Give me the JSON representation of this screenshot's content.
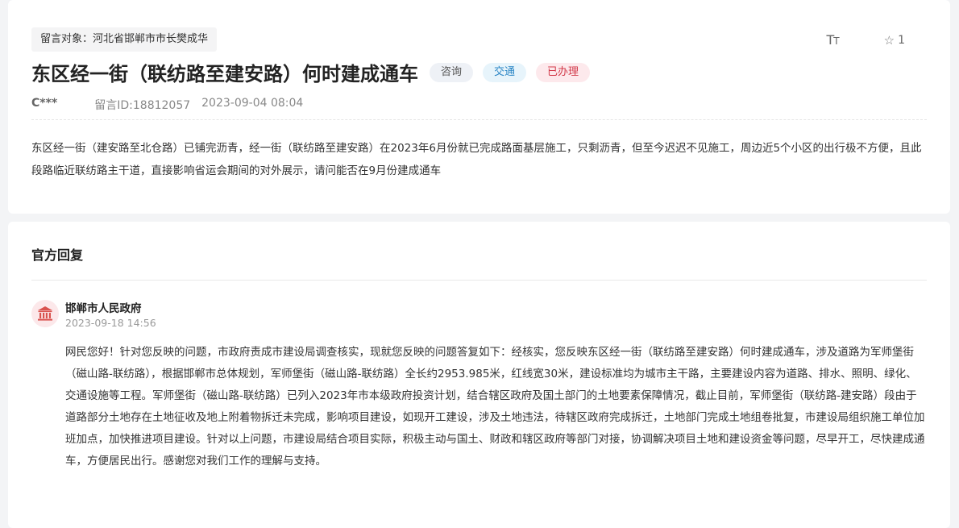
{
  "message": {
    "target_label": "留言对象：河北省邯郸市市长樊成华",
    "title": "东区经一街（联纺路至建安路）何时建成通车",
    "tags": [
      {
        "label": "咨询",
        "color": "#555555",
        "bg": "#eef1f6"
      },
      {
        "label": "交通",
        "color": "#2b86c5",
        "bg": "#e7f4fb"
      },
      {
        "label": "已办理",
        "color": "#d23a4a",
        "bg": "#fde9ec"
      }
    ],
    "author": "C***",
    "message_id": "留言ID:18812057",
    "datetime": "2023-09-04 08:04",
    "content": "东区经一街（建安路至北仓路）已铺完沥青，经一街（联纺路至建安路）在2023年6月份就已完成路面基层施工，只剩沥青，但至今迟迟不见施工，周边近5个小区的出行极不方便，且此段路临近联纺路主干道，直接影响省运会期间的对外展示，请问能否在9月份建成通车"
  },
  "toolbar": {
    "font_size_icon": "font-size-icon",
    "favorite_icon": "star-outline-icon",
    "favorite_count": "1"
  },
  "reply": {
    "heading": "官方回复",
    "avatar_icon": "government-building-icon",
    "avatar_color": "#d9534f",
    "department": "邯郸市人民政府",
    "datetime": "2023-09-18 14:56",
    "content": "网民您好！针对您反映的问题，市政府责成市建设局调查核实，现就您反映的问题答复如下：经核实，您反映东区经一街（联纺路至建安路）何时建成通车，涉及道路为军师堡街（磁山路-联纺路），根据邯郸市总体规划，军师堡街（磁山路-联纺路）全长约2953.985米，红线宽30米，建设标准均为城市主干路，主要建设内容为道路、排水、照明、绿化、交通设施等工程。军师堡街（磁山路-联纺路）已列入2023年市本级政府投资计划，结合辖区政府及国土部门的土地要素保障情况，截止目前，军师堡街（联纺路-建安路）段由于道路部分土地存在土地征收及地上附着物拆迁未完成，影响项目建设，如现开工建设，涉及土地违法，待辖区政府完成拆迁，土地部门完成土地组卷批复，市建设局组织施工单位加班加点，加快推进项目建设。针对以上问题，市建设局结合项目实际，积极主动与国土、财政和辖区政府等部门对接，协调解决项目土地和建设资金等问题，尽早开工，尽快建成通车，方便居民出行。感谢您对我们工作的理解与支持。"
  }
}
